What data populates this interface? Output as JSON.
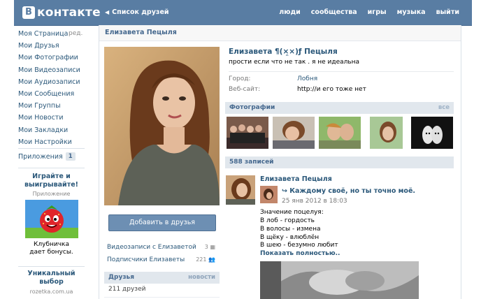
{
  "header": {
    "logo_letter": "В",
    "logo_text": "контакте",
    "back_label": "Список друзей",
    "nav": [
      "люди",
      "сообщества",
      "игры",
      "музыка",
      "выйти"
    ]
  },
  "leftmenu": {
    "items": [
      "Моя Страница",
      "Мои Друзья",
      "Мои Фотографии",
      "Мои Видеозаписи",
      "Мои Аудиозаписи",
      "Мои Сообщения",
      "Мои Группы",
      "Мои Новости",
      "Мои Закладки",
      "Мои Настройки"
    ],
    "edit_label": "ред.",
    "apps_label": "Приложения",
    "apps_count": "1"
  },
  "ad1": {
    "title_line1": "Играйте и",
    "title_line2": "выигрывайте!",
    "subtitle": "Приложение",
    "text_line1": "Клубничка",
    "text_line2": "дает бонусы."
  },
  "ad2": {
    "title_line1": "Уникальный",
    "title_line2": "выбор",
    "subtitle": "rozetka.com.ua"
  },
  "page": {
    "head_title": "Елизавета Пецыля",
    "add_friend_label": "Добавить в друзья",
    "videos_label": "Видеозаписи с Елизаветой",
    "videos_count": "3",
    "subscribers_label": "Подписчики Елизаветы",
    "subscribers_count": "221",
    "friends_title": "Друзья",
    "friends_link": "новости",
    "friends_count": "211 друзей"
  },
  "profile": {
    "name": "Елизавета ¶(×̯×)ƒ Пецыля",
    "status": "прости если что не так . я не идеальна",
    "city_label": "Город:",
    "city_value": "Лобня",
    "site_label": "Веб-сайт:",
    "site_value": "http://и его тоже нет"
  },
  "photos": {
    "title": "Фотографии",
    "all_label": "все"
  },
  "wall": {
    "count_title": "588 записей",
    "author": "Елизавета Пецыля",
    "repost_title": "Каждому своё, но ты точно моё.",
    "repost_date": "25 янв 2012 в 18:03",
    "lines": [
      "Значение поцелуя:",
      "В лоб - гордость",
      "В волосы - измена",
      "В щёку - влюблён",
      "В шею - безумно любит"
    ],
    "more_label": "Показать полностью.."
  },
  "colors": {
    "header_bg": "#597da3",
    "link": "#2b587a",
    "section_bar": "#e1e7ed",
    "button": "#6d8fb3"
  }
}
